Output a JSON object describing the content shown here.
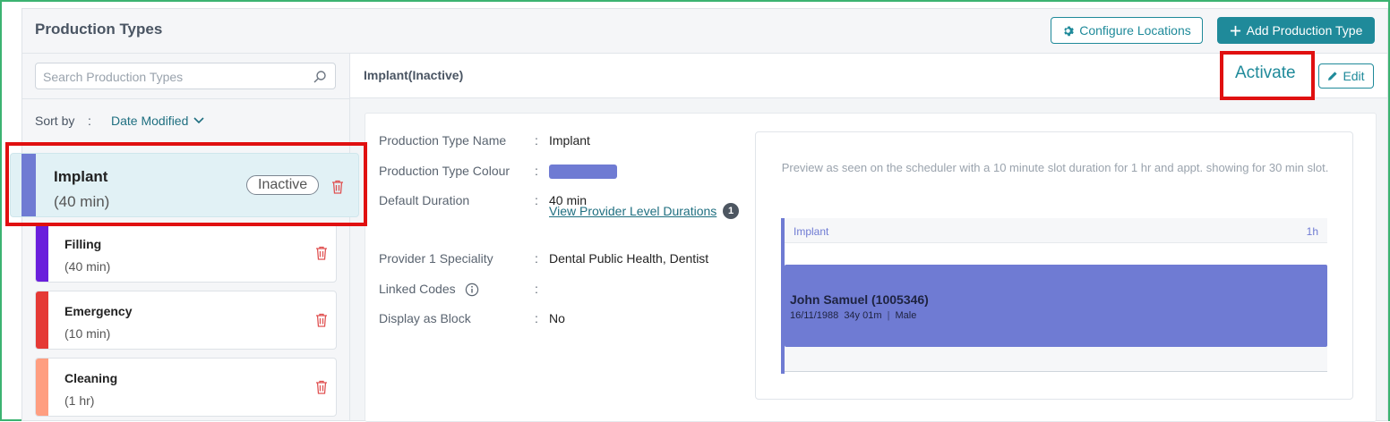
{
  "header": {
    "title": "Production Types",
    "configure_label": "Configure Locations",
    "add_label": "Add Production Type"
  },
  "sidebar": {
    "search_placeholder": "Search Production Types",
    "sort_label": "Sort by",
    "sort_colon": ":",
    "sort_value": "Date Modified",
    "items": [
      {
        "name": "Implant",
        "duration": "(40 min)",
        "status": "Inactive",
        "color": "#6f7bd3",
        "selected": true
      },
      {
        "name": "Filling",
        "duration": "(40 min)",
        "color": "#6a1fdc"
      },
      {
        "name": "Emergency",
        "duration": "(10 min)",
        "color": "#e53935"
      },
      {
        "name": "Cleaning",
        "duration": "(1 hr)",
        "color": "#ff9e80"
      }
    ]
  },
  "detail": {
    "title": "Implant(Inactive)",
    "activate_label": "Activate",
    "edit_label": "Edit",
    "fields": {
      "name_label": "Production Type Name",
      "name_value": "Implant",
      "colour_label": "Production Type Colour",
      "colour_value": "#6f7bd3",
      "duration_label": "Default Duration",
      "duration_value": "40 min",
      "provider_link": "View Provider Level Durations",
      "provider_count": "1",
      "speciality_label": "Provider 1 Speciality",
      "speciality_value": "Dental Public Health, Dentist",
      "linked_label": "Linked Codes",
      "linked_value": "",
      "block_label": "Display as Block",
      "block_value": "No",
      "colon": ":"
    },
    "preview": {
      "text": "Preview as seen on the scheduler with a 10 minute slot duration for 1 hr and appt. showing for 30 min slot.",
      "label": "Implant",
      "duration": "1h",
      "patient": "John Samuel (1005346)",
      "dob": "16/11/1988",
      "age": "34y 01m",
      "sex": "Male"
    }
  },
  "colors": {
    "accent": "#1f8a9a",
    "highlight": "#e01010",
    "implant": "#6f7bd3"
  }
}
